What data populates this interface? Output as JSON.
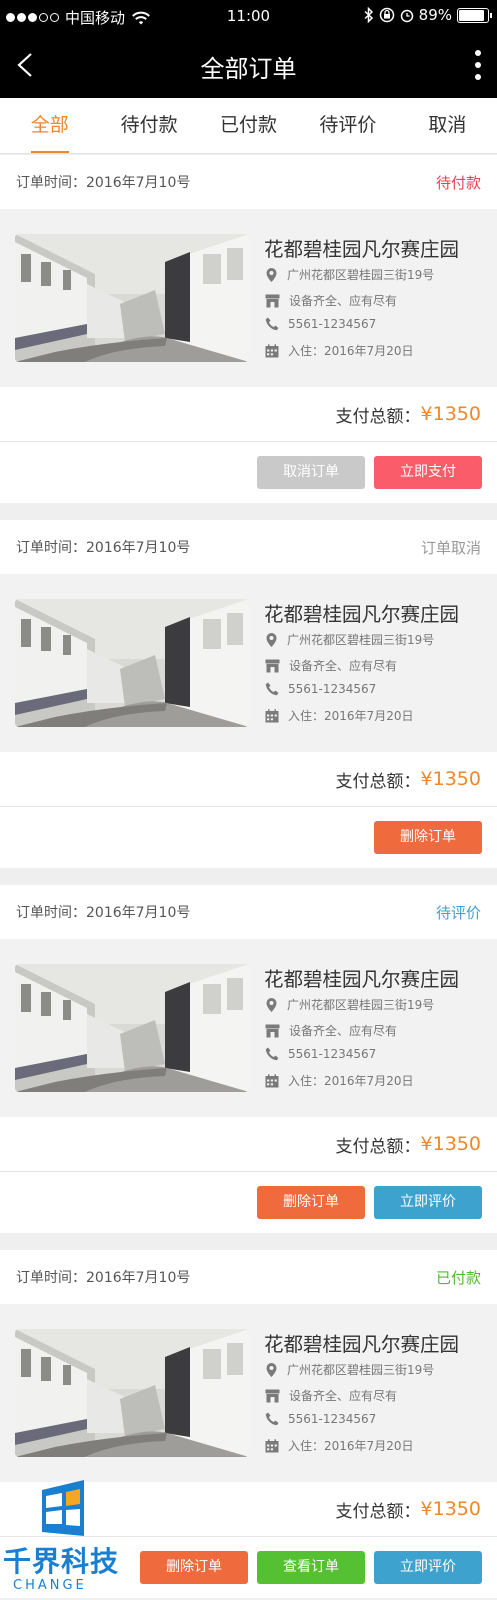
{
  "status_bar": {
    "carrier": "中国移动",
    "time": "11:00",
    "battery": "89%",
    "battery_level": 0.89
  },
  "nav": {
    "title": "全部订单",
    "back_icon": "back-icon",
    "more_icon": "more-vertical-icon"
  },
  "tabs": [
    {
      "label": "全部",
      "active": true
    },
    {
      "label": "待付款",
      "active": false
    },
    {
      "label": "已付款",
      "active": false
    },
    {
      "label": "待评价",
      "active": false
    },
    {
      "label": "取消",
      "active": false
    }
  ],
  "orders": [
    {
      "time": "订单时间：2016年7月10号",
      "status": "待付款",
      "status_color": "#e8434c",
      "name": "花都碧桂园凡尔赛庄园",
      "address": "广州花都区碧桂园三街19号",
      "facilities": "设备齐全、应有尽有",
      "phone": "5561-1234567",
      "checkin_label": "入住：",
      "checkin_date": "2016年7月20日",
      "total_label": "支付总额：",
      "total_amount": "¥1350",
      "buttons": [
        {
          "label": "取消订单",
          "color": "gray"
        },
        {
          "label": "立即支付",
          "color": "pink"
        }
      ]
    },
    {
      "time": "订单时间：2016年7月10号",
      "status": "订单取消",
      "status_color": "#999999",
      "name": "花都碧桂园凡尔赛庄园",
      "address": "广州花都区碧桂园三街19号",
      "facilities": "设备齐全、应有尽有",
      "phone": "5561-1234567",
      "checkin_label": "入住：",
      "checkin_date": "2016年7月20日",
      "total_label": "支付总额：",
      "total_amount": "¥1350",
      "buttons": [
        {
          "label": "删除订单",
          "color": "orange"
        }
      ]
    },
    {
      "time": "订单时间：2016年7月10号",
      "status": "待评价",
      "status_color": "#3ea2cf",
      "name": "花都碧桂园凡尔赛庄园",
      "address": "广州花都区碧桂园三街19号",
      "facilities": "设备齐全、应有尽有",
      "phone": "5561-1234567",
      "checkin_label": "入住：",
      "checkin_date": "2016年7月20日",
      "total_label": "支付总额：",
      "total_amount": "¥1350",
      "buttons": [
        {
          "label": "删除订单",
          "color": "orange"
        },
        {
          "label": "立即评价",
          "color": "blue"
        }
      ]
    },
    {
      "time": "订单时间：2016年7月10号",
      "status": "已付款",
      "status_color": "#55b533",
      "name": "花都碧桂园凡尔赛庄园",
      "address": "广州花都区碧桂园三街19号",
      "facilities": "设备齐全、应有尽有",
      "phone": "5561-1234567",
      "checkin_label": "入住：",
      "checkin_date": "2016年7月20日",
      "total_label": "支付总额：",
      "total_amount": "¥1350",
      "buttons": [
        {
          "label": "删除订单",
          "color": "orange"
        },
        {
          "label": "查看订单",
          "color": "green"
        },
        {
          "label": "立即评价",
          "color": "blue"
        }
      ]
    }
  ],
  "watermark": {
    "cn": "千界科技",
    "en": "CHANGE"
  },
  "colors": {
    "accent": "#f0872a",
    "header_bg": "#000000"
  }
}
